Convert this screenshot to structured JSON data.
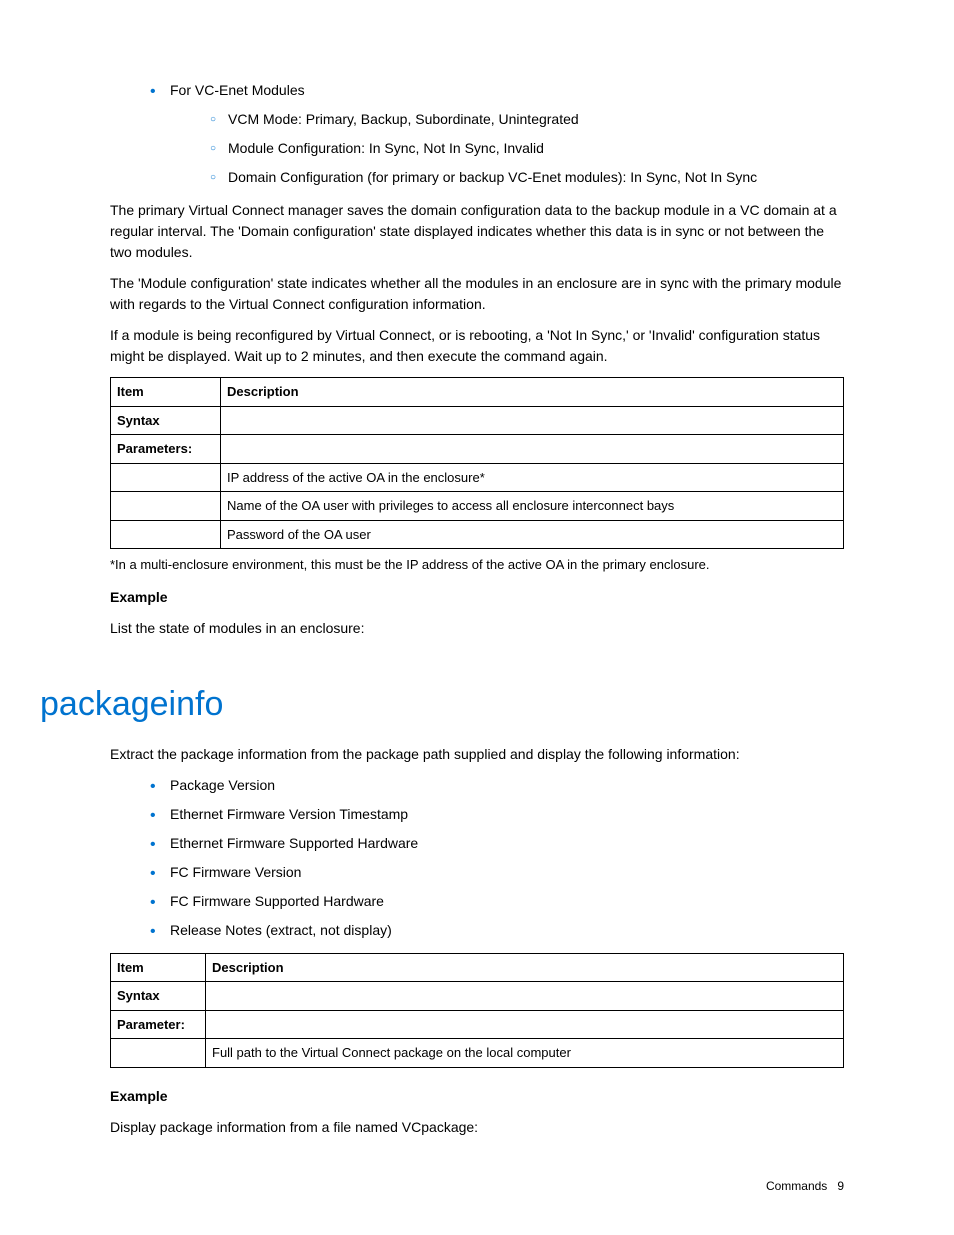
{
  "topList": {
    "item1": "For VC-Enet Modules",
    "sub1": "VCM Mode: Primary, Backup, Subordinate, Unintegrated",
    "sub2": "Module Configuration: In Sync, Not In Sync, Invalid",
    "sub3": "Domain Configuration (for primary or backup VC-Enet modules): In Sync, Not In Sync"
  },
  "para1": "The primary Virtual Connect manager saves the domain configuration data to the backup module in a VC domain at a regular interval. The 'Domain configuration' state displayed indicates whether this data is in sync or not between the two modules.",
  "para2": "The 'Module configuration' state indicates whether all the modules in an enclosure are in sync with the primary module with regards to the Virtual Connect configuration information.",
  "para3": "If a module is being reconfigured by Virtual Connect, or is rebooting, a 'Not In Sync,' or 'Invalid' configuration status might be displayed. Wait up to 2 minutes, and then execute the command again.",
  "table1": {
    "headers": {
      "col1": "Item",
      "col2": "Description"
    },
    "rows": {
      "r1": {
        "item": "Syntax",
        "desc": ""
      },
      "r2": {
        "item": "Parameters:",
        "desc": ""
      },
      "r3": {
        "item": "",
        "desc": "IP address of the active OA in the enclosure*"
      },
      "r4": {
        "item": "",
        "desc": "Name of the OA user with privileges to access all enclosure interconnect bays"
      },
      "r5": {
        "item": "",
        "desc": "Password of the OA user"
      }
    }
  },
  "footnote1": "*In a multi-enclosure environment, this must be the IP address of the active OA in the primary enclosure.",
  "example1Label": "Example",
  "example1Text": "List the state of modules in an enclosure:",
  "sectionTitle": "packageinfo",
  "para4": "Extract the package information from the package path supplied and display the following information:",
  "pkgList": {
    "i1": "Package Version",
    "i2": "Ethernet Firmware Version Timestamp",
    "i3": "Ethernet Firmware Supported Hardware",
    "i4": "FC Firmware Version",
    "i5": "FC Firmware Supported Hardware",
    "i6": "Release Notes (extract, not display)"
  },
  "table2": {
    "headers": {
      "col1": "Item",
      "col2": "Description"
    },
    "rows": {
      "r1": {
        "item": "Syntax",
        "desc": ""
      },
      "r2": {
        "item": "Parameter:",
        "desc": ""
      },
      "r3": {
        "item": "",
        "desc": "Full path to the Virtual Connect package on the local computer"
      }
    }
  },
  "example2Label": "Example",
  "example2Text": "Display package information from a file named VCpackage:",
  "footer": {
    "section": "Commands",
    "page": "9"
  }
}
